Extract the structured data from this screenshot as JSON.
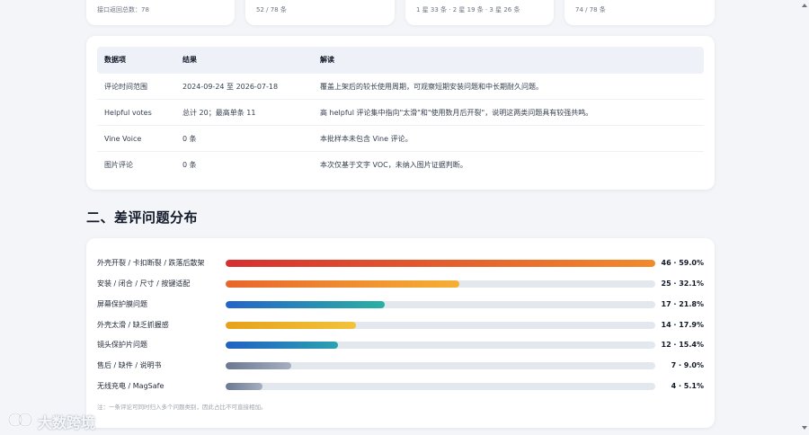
{
  "stat_cards": [
    {
      "text": "接口返回总数：78"
    },
    {
      "text": "52 / 78 条"
    },
    {
      "text": "1 星 33 条 · 2 星 19 条 · 3 星 26 条"
    },
    {
      "text": "74 / 78 条"
    }
  ],
  "table": {
    "headers": [
      "数据项",
      "结果",
      "解读"
    ],
    "rows": [
      {
        "item": "评论时间范围",
        "result": "2024-09-24 至 2026-07-18",
        "note": "覆盖上架后的较长使用周期，可观察短期安装问题和中长期耐久问题。"
      },
      {
        "item": "Helpful votes",
        "result": "总计 20；最高单条 11",
        "note": "高 helpful 评论集中指向\"太滑\"和\"使用数月后开裂\"，说明这两类问题具有较强共鸣。"
      },
      {
        "item": "Vine Voice",
        "result": "0 条",
        "note": "本批样本未包含 Vine 评论。"
      },
      {
        "item": "图片评论",
        "result": "0 条",
        "note": "本次仅基于文字 VOC，未纳入图片证据判断。"
      }
    ]
  },
  "section": {
    "title": "二、差评问题分布"
  },
  "distribution": {
    "items": [
      {
        "label": "外壳开裂 / 卡扣断裂 / 跌落后散架",
        "count": 46,
        "percent": 59.0,
        "value_text": "46 · 59.0%",
        "gradient": [
          "#d62f2f",
          "#f28a2b"
        ]
      },
      {
        "label": "安装 / 闭合 / 尺寸 / 按键适配",
        "count": 25,
        "percent": 32.1,
        "value_text": "25 · 32.1%",
        "gradient": [
          "#e8652c",
          "#f5b034"
        ]
      },
      {
        "label": "屏幕保护膜问题",
        "count": 17,
        "percent": 21.8,
        "value_text": "17 · 21.8%",
        "gradient": [
          "#2563c9",
          "#2bb0a3"
        ]
      },
      {
        "label": "外壳太滑 / 缺乏抓握感",
        "count": 14,
        "percent": 17.9,
        "value_text": "14 · 17.9%",
        "gradient": [
          "#e6a11a",
          "#f3c23b"
        ]
      },
      {
        "label": "镜头保护片问题",
        "count": 12,
        "percent": 15.4,
        "value_text": "12 · 15.4%",
        "gradient": [
          "#2160c4",
          "#2aa2b0"
        ]
      },
      {
        "label": "售后 / 缺件 / 说明书",
        "count": 7,
        "percent": 9.0,
        "value_text": "7 · 9.0%",
        "gradient": [
          "#6b7891",
          "#a5afc0"
        ]
      },
      {
        "label": "无线充电 / MagSafe",
        "count": 4,
        "percent": 5.1,
        "value_text": "4 · 5.1%",
        "gradient": [
          "#6b7891",
          "#a5afc0"
        ]
      }
    ],
    "max_percent": 59.0,
    "note": "注：一条评论可同时归入多个问题类别，因此占比不可直接相加。"
  },
  "watermark": {
    "text": "大数跨境"
  }
}
